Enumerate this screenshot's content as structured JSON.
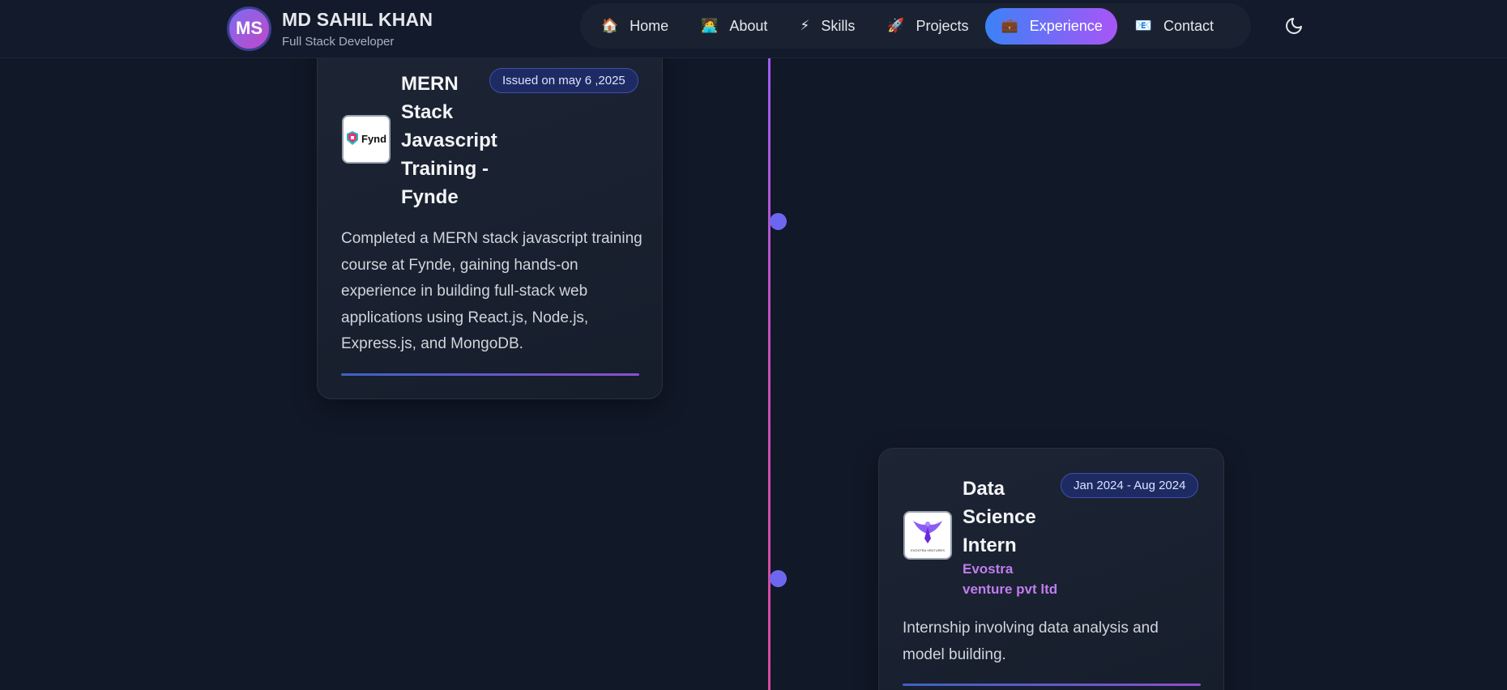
{
  "brand": {
    "initials": "MS",
    "name": "MD SAHIL KHAN",
    "subtitle": "Full Stack Developer"
  },
  "nav": {
    "items": [
      {
        "icon": "🏠",
        "label": "Home"
      },
      {
        "icon": "🧑‍💻",
        "label": "About"
      },
      {
        "icon": "⚡",
        "label": "Skills"
      },
      {
        "icon": "🚀",
        "label": "Projects"
      },
      {
        "icon": "💼",
        "label": "Experience"
      },
      {
        "icon": "📧",
        "label": "Contact"
      }
    ],
    "active": "Experience"
  },
  "timeline": [
    {
      "title": "MERN\nStack\nJavascript\nTraining -\nFynde",
      "company": "",
      "date": "Issued on may 6 ,2025",
      "logo_text": "Fynd",
      "description": "Completed a MERN stack javascript training course at Fynde, gaining hands-on experience in building full-stack web applications using React.js, Node.js, Express.js, and MongoDB."
    },
    {
      "title": "Data\nScience\nIntern",
      "company": "Evostra\nventure pvt ltd",
      "date": "Jan 2024 - Aug 2024",
      "logo_text": "EVOSTRA VENTURES",
      "description": "Internship involving data analysis and model building."
    }
  ],
  "colors": {
    "background": "#111827",
    "accent_start": "#3b82f6",
    "accent_end": "#a855f7",
    "company_text": "#c07cf0",
    "timeline_dot": "#6d67f0"
  }
}
